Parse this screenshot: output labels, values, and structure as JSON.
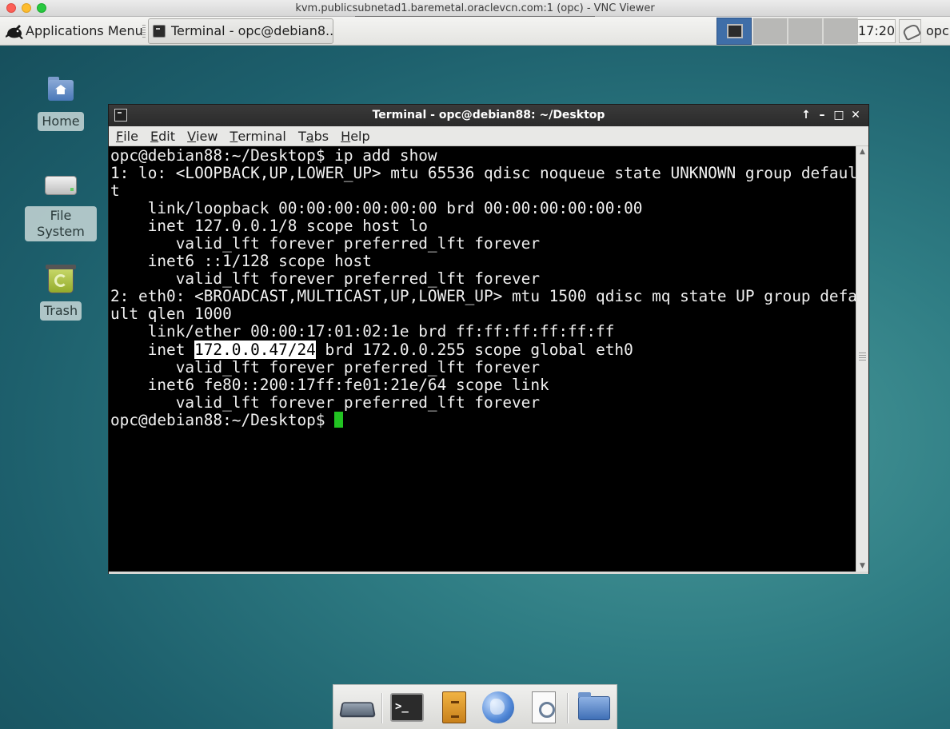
{
  "mac_window": {
    "title": "kvm.publicsubnetad1.baremetal.oraclevcn.com:1 (opc) - VNC Viewer"
  },
  "panel": {
    "apps_menu_label": "Applications Menu",
    "task_button_label": "Terminal - opc@debian8...",
    "clock": "17:20",
    "user": "opc"
  },
  "desktop_icons": [
    {
      "label": "Home",
      "icon": "home-folder-icon"
    },
    {
      "label": "File System",
      "icon": "drive-icon"
    },
    {
      "label": "Trash",
      "icon": "trash-icon"
    }
  ],
  "terminal": {
    "title": "Terminal - opc@debian88: ~/Desktop",
    "controls": {
      "up": "↑",
      "minimize": "–",
      "maximize": "□",
      "close": "✕"
    },
    "menu": [
      "File",
      "Edit",
      "View",
      "Terminal",
      "Tabs",
      "Help"
    ],
    "menu_mnemonics": [
      "F",
      "E",
      "V",
      "T",
      "T",
      "H"
    ],
    "lines": [
      "opc@debian88:~/Desktop$ ip add show",
      "1: lo: <LOOPBACK,UP,LOWER_UP> mtu 65536 qdisc noqueue state UNKNOWN group defaul",
      "t",
      "    link/loopback 00:00:00:00:00:00 brd 00:00:00:00:00:00",
      "    inet 127.0.0.1/8 scope host lo",
      "       valid_lft forever preferred_lft forever",
      "    inet6 ::1/128 scope host",
      "       valid_lft forever preferred_lft forever",
      "2: eth0: <BROADCAST,MULTICAST,UP,LOWER_UP> mtu 1500 qdisc mq state UP group defa",
      "ult qlen 1000",
      "    link/ether 00:00:17:01:02:1e brd ff:ff:ff:ff:ff:ff",
      "    inet ",
      "       valid_lft forever preferred_lft forever",
      "    inet6 fe80::200:17ff:fe01:21e/64 scope link",
      "       valid_lft forever preferred_lft forever",
      "opc@debian88:~/Desktop$ "
    ],
    "highlight_line": {
      "prefix": "    inet ",
      "selected": "172.0.0.47/24",
      "suffix": " brd 172.0.0.255 scope global eth0"
    },
    "cursor_color": "#22c322"
  },
  "dock": {
    "items": [
      "drive-icon",
      "terminal-icon",
      "file-cabinet-icon",
      "web-browser-globe-icon",
      "app-finder-search-icon",
      "folder-icon"
    ]
  }
}
